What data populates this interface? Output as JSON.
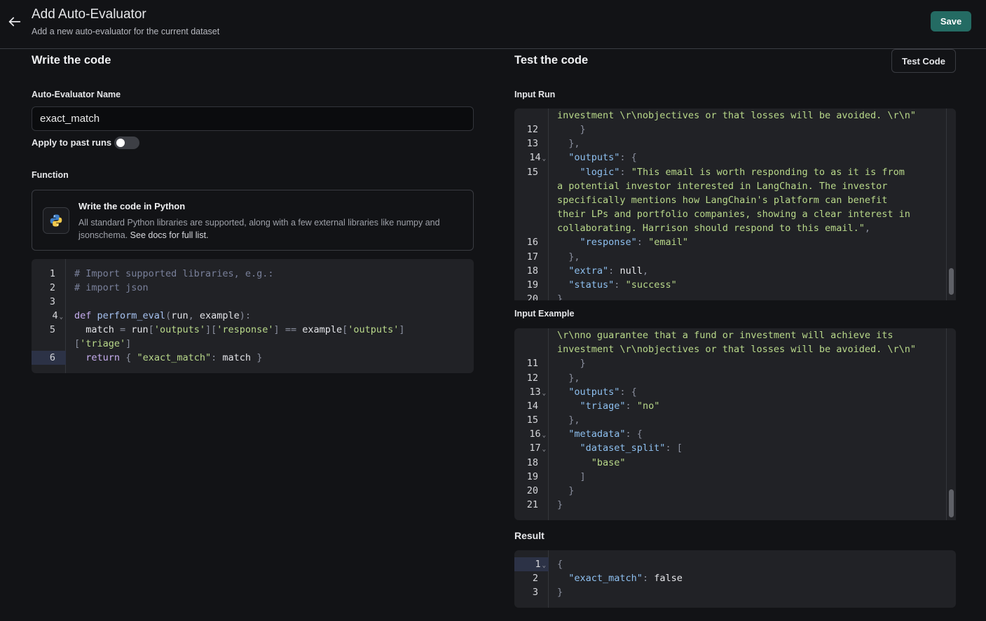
{
  "header": {
    "title": "Add Auto-Evaluator",
    "subtitle": "Add a new auto-evaluator for the current dataset",
    "save_label": "Save",
    "back_icon": "arrow-left-icon"
  },
  "left": {
    "section_title": "Write the code",
    "name_label": "Auto-Evaluator Name",
    "name_value": "exact_match",
    "apply_label": "Apply to past runs",
    "apply_enabled": false,
    "function_label": "Function",
    "function_card": {
      "icon": "python-icon",
      "title": "Write the code in Python",
      "description": "All standard Python libraries are supported, along with a few external libraries like numpy and jsonschema.",
      "link": "See docs for full list."
    },
    "code_line_numbers": [
      "1",
      "2",
      "3",
      "4",
      "5",
      "",
      "6"
    ]
  },
  "right": {
    "section_title": "Test the code",
    "test_label": "Test Code",
    "input_run_label": "Input Run",
    "input_run_line_numbers": [
      "",
      "12",
      "13",
      "14",
      "15",
      "",
      "",
      "",
      "",
      "16",
      "17",
      "18",
      "19",
      "20"
    ],
    "input_example_label": "Input Example",
    "input_example_line_numbers": [
      "",
      "",
      "11",
      "12",
      "13",
      "14",
      "15",
      "16",
      "17",
      "18",
      "19",
      "20",
      "21"
    ],
    "result_label": "Result",
    "result_line_numbers": [
      "1",
      "2",
      "3"
    ]
  },
  "colors": {
    "background": "#121316",
    "editor": "#212226",
    "accent": "#246b63",
    "string": "#b9d98a",
    "keyword": "#c7aef0",
    "json_key": "#8ec0f0"
  }
}
